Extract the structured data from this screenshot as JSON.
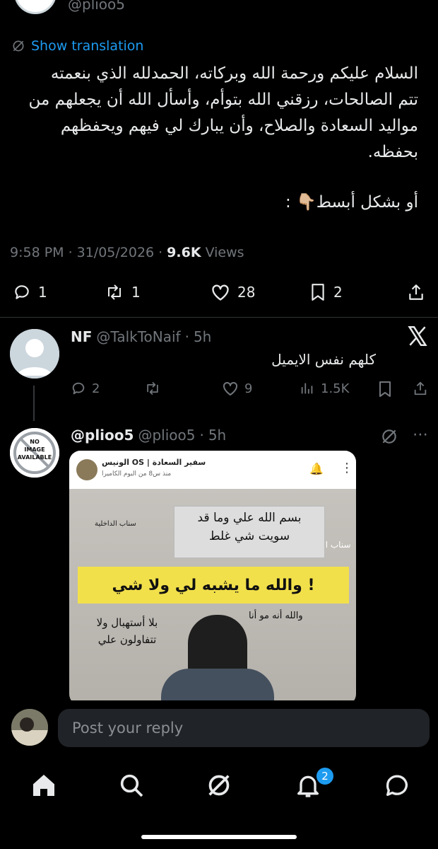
{
  "top_tweet": {
    "handle_partial": "@plioo5",
    "show_translation": "Show translation",
    "text_lines": [
      "السلام عليكم ورحمة الله وبركاته، الحمدلله الذي بنعمته",
      "تتم الصالحات، رزقني الله بتوأم، وأسأل الله أن يجعلهم من",
      "مواليد السعادة والصلاح، وأن يبارك لي فيهم ويحفظهم",
      "بحفظه."
    ],
    "text_extra": "أو بشكل أبسط👇🏼 :",
    "time": "9:58 PM",
    "date": "31/05/2026",
    "views_count": "9.6K",
    "views_label": "Views",
    "replies": "1",
    "reposts": "1",
    "likes": "28",
    "bookmarks": "2"
  },
  "reply1": {
    "name": "NF",
    "handle": "@TalkToNaif",
    "time": "5h",
    "text": "كلهم نفس الايميل",
    "replies": "2",
    "likes": "9",
    "views": "1.5K"
  },
  "reply2": {
    "name": "@plioo5",
    "handle": "@plioo5",
    "time": "5h",
    "avatar_text": [
      "NO",
      "IMAGE",
      "AVAILABLE"
    ],
    "media": {
      "profile_name": "الونيس OS | سفير السعادة",
      "profile_sub": "منذ س8 من البوم الكاميرا",
      "side_left": "سناب الداخلية",
      "side_right": "سناب ال",
      "caption1a": "بسم الله علي وما قد",
      "caption1b": "سويت شي غلط",
      "caption2": "والله ما يشبه لي ولا شي !",
      "caption3": "والله أنه مو أنا",
      "caption4a": "بلا أستهبال ولا",
      "caption4b": "تتفاولون علي"
    }
  },
  "composer": {
    "placeholder": "Post your reply"
  },
  "nav": {
    "notifications_badge": "2"
  },
  "colors": {
    "accent": "#1d9bf0",
    "muted": "#71767b",
    "background": "#000000"
  }
}
